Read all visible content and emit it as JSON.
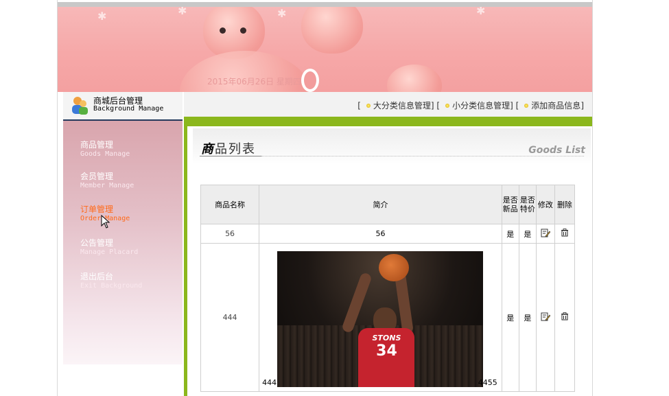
{
  "banner": {
    "date_text": "2015年06月26日 星期四"
  },
  "sidebar": {
    "header_cn": "商城后台管理",
    "header_en": "Background Manage",
    "items": [
      {
        "cn": "商品管理",
        "en": "Goods Manage",
        "active": false
      },
      {
        "cn": "会员管理",
        "en": "Member Manage",
        "active": false
      },
      {
        "cn": "订单管理",
        "en": "Order Manage",
        "active": true
      },
      {
        "cn": "公告管理",
        "en": "Manage Placard",
        "active": false
      },
      {
        "cn": "退出后台",
        "en": "Exit Background",
        "active": false
      }
    ]
  },
  "topnav": {
    "links": [
      "大分类信息管理",
      "小分类信息管理",
      "添加商品信息"
    ]
  },
  "content": {
    "title_cn_bold": "商",
    "title_cn_rest": "品列表",
    "title_en": "Goods List"
  },
  "table": {
    "headers": [
      "商品名称",
      "简介",
      "是否新品",
      "是否特价",
      "修改",
      "删除"
    ],
    "rows": [
      {
        "name": "56",
        "desc": "56",
        "is_new": "是",
        "is_special": "是"
      },
      {
        "name": "444",
        "desc_left": "444",
        "desc_right": "4455",
        "is_new": "是",
        "is_special": "是",
        "photo_team": "STONS",
        "photo_number": "34"
      }
    ]
  },
  "colors": {
    "accent_green": "#8bb71c",
    "active_orange": "#ff6a1a",
    "banner_pink": "#f6a8a8"
  }
}
